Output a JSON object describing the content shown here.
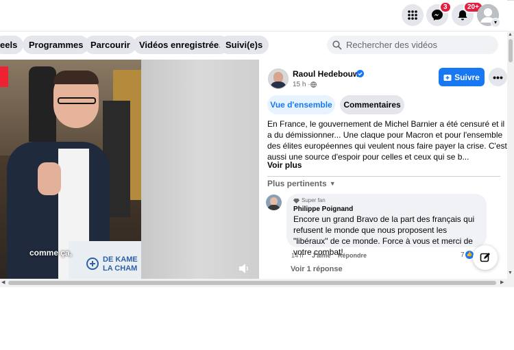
{
  "topbar": {
    "messenger_badge": "3",
    "notifications_badge": "20+"
  },
  "nav": {
    "tabs": [
      "eels",
      "Programmes",
      "Parcourir",
      "Vidéos enregistrées",
      "Suivi(e)s"
    ],
    "search_placeholder": "Rechercher des vidéos"
  },
  "video": {
    "caption": "comme ça,",
    "podium_text_1": "DE KAME",
    "podium_text_2": "LA CHAM"
  },
  "post": {
    "author": "Raoul Hedebouw",
    "time": "15 h ·",
    "follow_label": "Suivre",
    "tab_overview": "Vue d'ensemble",
    "tab_comments": "Commentaires",
    "text": "En France, le gouvernement de Michel Barnier a été censuré et il a du démissionner... Une claque pour Macron et pour l'ensemble des élites européennes qui veulent nous faire payer la crise. C'est aussi une source d'espoir pour celles et ceux qui se b...",
    "see_more": "Voir plus",
    "sort_label": "Plus pertinents"
  },
  "comment": {
    "badge": "Super fan",
    "author": "Philippe Poignand",
    "text": "Encore un grand Bravo de la part des français qui refusent le monde que nous proposent les \"libéraux\" de ce monde. Force à vous et merci de votre combat!",
    "time": "14 h",
    "like": "J'aime",
    "reply": "Répondre",
    "reaction_count": "7",
    "view_replies": "Voir 1 réponse"
  },
  "colors": {
    "accent": "#1877f2",
    "badge_red": "#e41e3f"
  }
}
